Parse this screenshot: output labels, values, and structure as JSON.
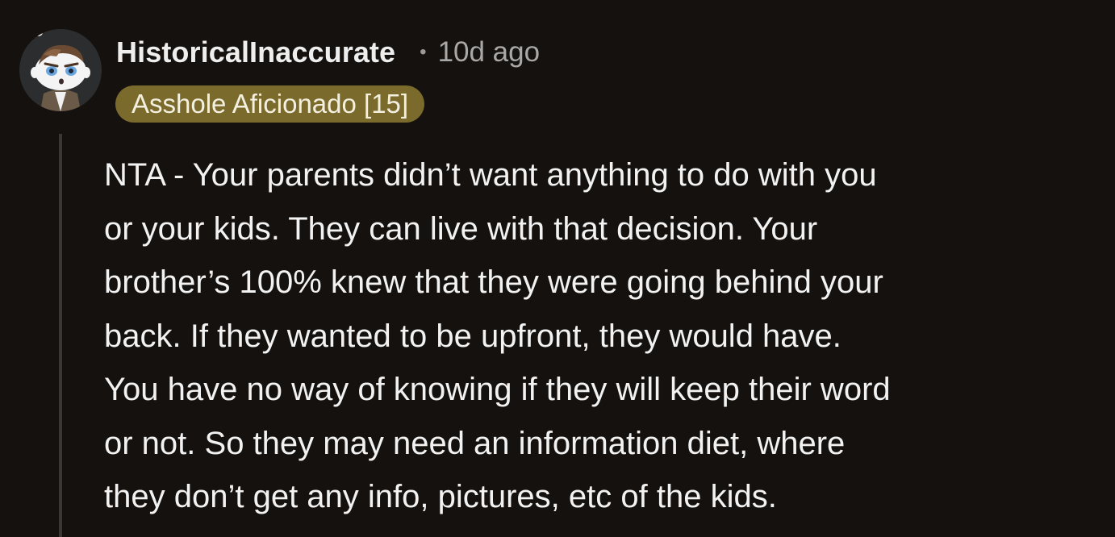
{
  "comment": {
    "author": "HistoricalInaccurate",
    "separator": "•",
    "timestamp": "10d ago",
    "flair": "Asshole Aficionado [15]",
    "body_lines": [
      "NTA - Your parents didn’t want anything to do with you",
      "or your kids. They can live with that decision. Your",
      "brother’s 100% knew that they were going behind your",
      "back. If they wanted to be upfront, they would have.",
      "You have no way of knowing if they will keep their word",
      "or not. So they may need an information diet, where",
      "they don’t get any info, pictures, etc of the kids."
    ]
  },
  "icons": {
    "avatar": "reddit-snoo-avatar-icon"
  },
  "colors": {
    "background": "#15110e",
    "flair_background": "#7a6a2c",
    "text": "#f2f2f2",
    "muted": "#a8a8a8",
    "thread_line": "#3a3836"
  }
}
